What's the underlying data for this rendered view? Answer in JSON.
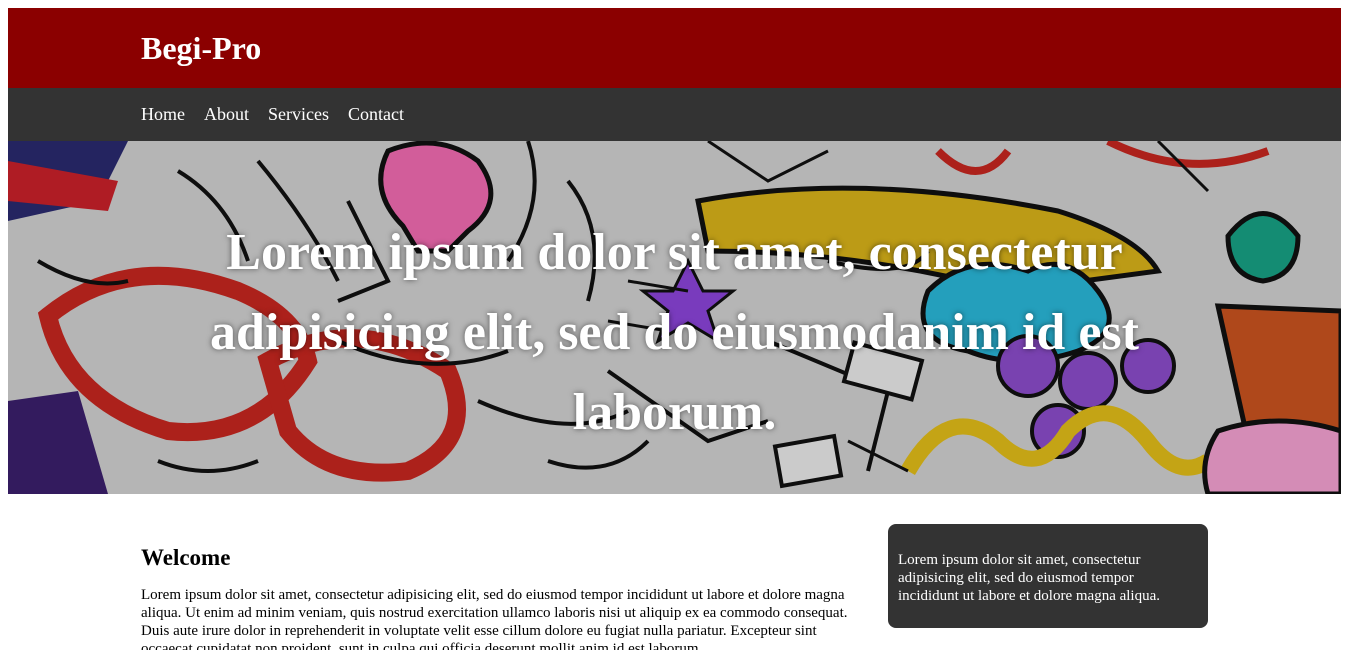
{
  "header": {
    "brand": "Begi-Pro"
  },
  "nav": {
    "items": [
      {
        "label": "Home"
      },
      {
        "label": "About"
      },
      {
        "label": "Services"
      },
      {
        "label": "Contact"
      }
    ]
  },
  "hero": {
    "headline": "Lorem ipsum dolor sit amet, consectetur adipisicing elit, sed do eiusmodanim id est laborum."
  },
  "main": {
    "heading": "Welcome",
    "paragraph": "Lorem ipsum dolor sit amet, consectetur adipisicing elit, sed do eiusmod tempor incididunt ut labore et dolore magna aliqua. Ut enim ad minim veniam, quis nostrud exercitation ullamco laboris nisi ut aliquip ex ea commodo consequat. Duis aute irure dolor in reprehenderit in voluptate velit esse cillum dolore eu fugiat nulla pariatur. Excepteur sint occaecat cupidatat non proident, sunt in culpa qui officia deserunt mollit anim id est laborum."
  },
  "sidebar": {
    "text": "Lorem ipsum dolor sit amet, consectetur adipisicing elit, sed do eiusmod tempor incididunt ut labore et dolore magna aliqua."
  },
  "colors": {
    "header_bg": "#8b0000",
    "nav_bg": "#333333",
    "sidebar_bg": "#333333",
    "text_light": "#ffffff"
  }
}
